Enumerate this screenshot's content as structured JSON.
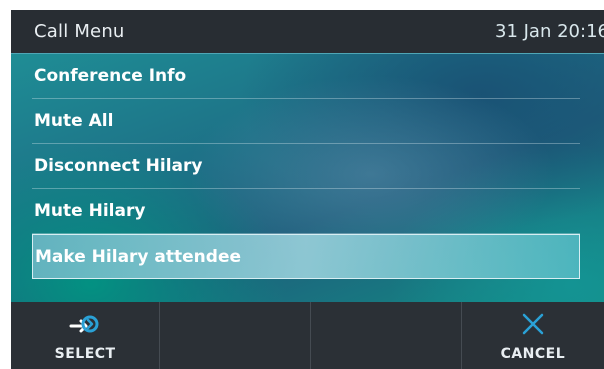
{
  "header": {
    "title": "Call Menu",
    "datetime": "31 Jan 20:16"
  },
  "menu": {
    "items": [
      {
        "label": "Conference Info"
      },
      {
        "label": "Mute All"
      },
      {
        "label": "Disconnect Hilary"
      },
      {
        "label": "Mute Hilary"
      },
      {
        "label": "Make Hilary attendee",
        "selected": true
      }
    ]
  },
  "softkeys": {
    "select": {
      "label": "SELECT",
      "icon": "select-arrow-icon"
    },
    "cancel": {
      "label": "CANCEL",
      "icon": "close-icon"
    }
  },
  "colors": {
    "header_bg": "#282d33",
    "accent": "#2aa1d6",
    "softkey_bg": "#2b3036"
  }
}
